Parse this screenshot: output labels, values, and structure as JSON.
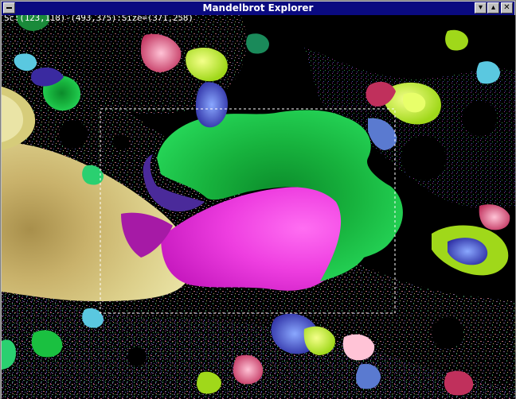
{
  "window": {
    "title": "Mandelbrot Explorer"
  },
  "controls": {
    "menu_icon": "window-menu-icon",
    "minimize_icon": "minimize-icon",
    "maximize_icon": "maximize-icon",
    "close_icon": "close-icon",
    "minimize_glyph": "▾",
    "maximize_glyph": "▴",
    "close_glyph": "✕"
  },
  "status": {
    "text": "Sc:(123,118)-(493,375):Size=(371,258)"
  },
  "colors": {
    "title_bar": "#0a0a80",
    "frame": "#c0c0c0",
    "selection": "#ffffff"
  }
}
